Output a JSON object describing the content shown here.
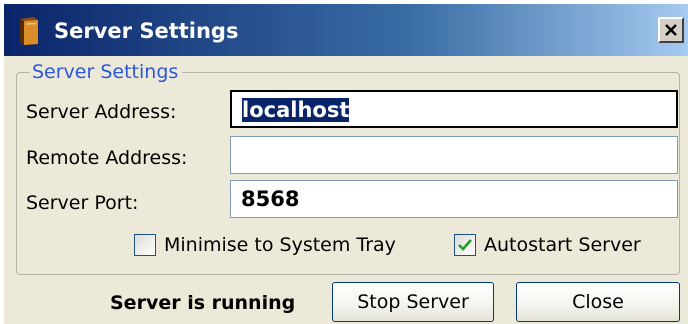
{
  "window": {
    "title": "Server Settings",
    "app_icon": "book-icon",
    "close_icon": "close-icon"
  },
  "group": {
    "legend": "Server Settings"
  },
  "fields": {
    "server_address": {
      "label": "Server Address:",
      "value": "localhost",
      "selected": true
    },
    "remote_address": {
      "label": "Remote Address:",
      "value": ""
    },
    "server_port": {
      "label": "Server Port:",
      "value": "8568"
    }
  },
  "options": {
    "minimise_to_tray": {
      "label": "Minimise to System Tray",
      "checked": false
    },
    "autostart_server": {
      "label": "Autostart Server",
      "checked": true
    }
  },
  "footer": {
    "status": "Server is running",
    "stop_button": "Stop Server",
    "close_button": "Close"
  },
  "colors": {
    "title_bar_start": "#0a246a",
    "title_bar_end": "#a6caf0",
    "legend_text": "#2b56d8",
    "window_background": "#ece9d8",
    "checkmark": "#21a121"
  }
}
